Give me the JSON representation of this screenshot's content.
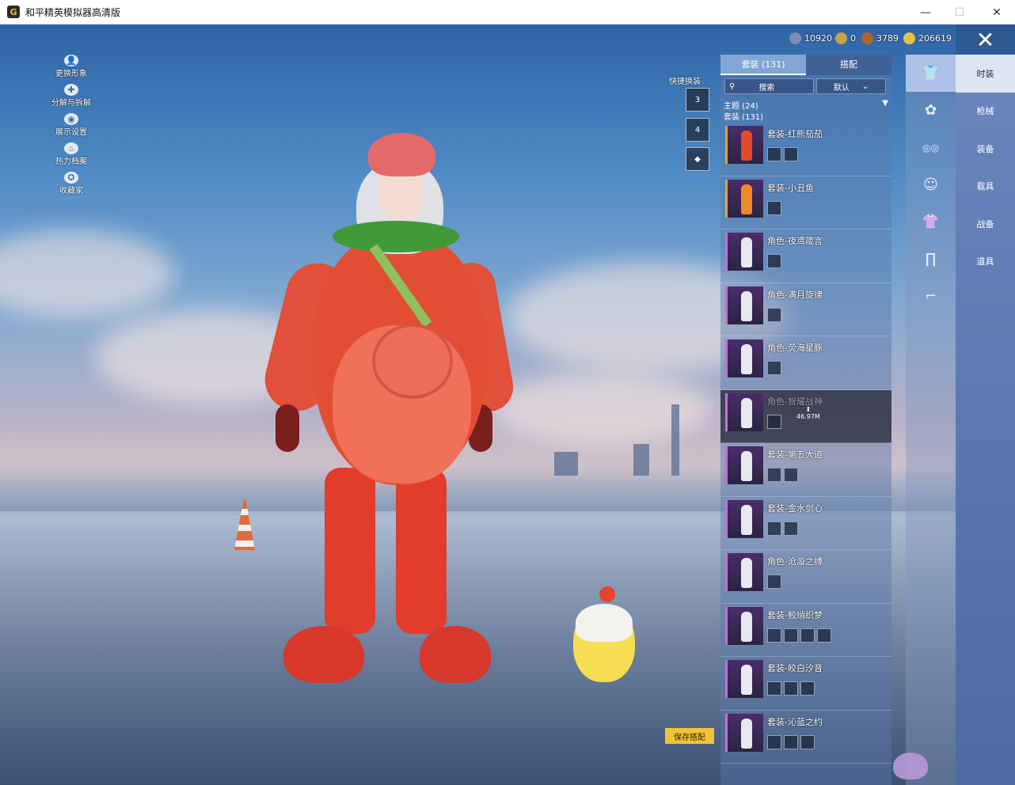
{
  "window": {
    "title": "和平精英模拟器高清版",
    "logo": "G",
    "minimize": "—",
    "maximize": "☐",
    "close": "✕"
  },
  "left_menu": [
    {
      "label": "更换形象",
      "icon": "person-icon",
      "glyph": "👤"
    },
    {
      "label": "分解与拆解",
      "icon": "puzzle-icon",
      "glyph": "✚"
    },
    {
      "label": "展示设置",
      "icon": "eye-icon",
      "glyph": "◉"
    },
    {
      "label": "热力档案",
      "icon": "flame-icon",
      "glyph": "♨"
    },
    {
      "label": "收藏家",
      "icon": "badge-icon",
      "glyph": "✪"
    }
  ],
  "currency": [
    {
      "value": "10920",
      "icon": "gem-icon",
      "color": "#7a8fb8"
    },
    {
      "value": "0",
      "icon": "medal-icon",
      "color": "#c9a14a"
    },
    {
      "value": "3789",
      "icon": "bronze-coin-icon",
      "color": "#b0662a"
    },
    {
      "value": "206619",
      "icon": "gold-coin-icon",
      "color": "#e6c34a"
    }
  ],
  "top_close": "✕",
  "quick_swap": {
    "label": "快捷换装",
    "slots": [
      "3",
      "4",
      "◆"
    ]
  },
  "list": {
    "tabs": [
      "套装 (131)",
      "搭配"
    ],
    "search_placeholder": "搜索",
    "sort": "默认",
    "theme": "主题 (24)",
    "theme_arrow": "▼",
    "set_count": "套装 (131)",
    "items": [
      {
        "name": "套装-红熊茄茄",
        "subs": 2,
        "fig": "red",
        "gold": true
      },
      {
        "name": "套装-小丑鱼",
        "subs": 1,
        "fig": "orange",
        "gold": true
      },
      {
        "name": "角色-夜鸢箴言",
        "subs": 1,
        "fig": "",
        "gold": false
      },
      {
        "name": "角色-满月旋律",
        "subs": 1,
        "fig": "",
        "gold": false
      },
      {
        "name": "角色-荧海星豚",
        "subs": 1,
        "fig": "",
        "gold": false
      },
      {
        "name": "角色-智耀战神",
        "subs": 1,
        "fig": "",
        "gold": false,
        "dim": true,
        "download": "46.97M"
      },
      {
        "name": "套装-第五大道",
        "subs": 2,
        "fig": "",
        "gold": false
      },
      {
        "name": "套装-金水剑心",
        "subs": 2,
        "fig": "",
        "gold": false
      },
      {
        "name": "角色-沧漩之缚",
        "subs": 1,
        "fig": "",
        "gold": false
      },
      {
        "name": "套装-鲛绡织梦",
        "subs": 4,
        "fig": "",
        "gold": false
      },
      {
        "name": "套装-皎白汐音",
        "subs": 3,
        "fig": "",
        "gold": false
      },
      {
        "name": "套装-沁蓝之约",
        "subs": 3,
        "fig": "",
        "gold": false
      }
    ]
  },
  "categories": [
    {
      "icon": "outfit-icon",
      "glyph": "👕"
    },
    {
      "icon": "hair-icon",
      "glyph": "✿"
    },
    {
      "icon": "glasses-icon",
      "glyph": "◎◎"
    },
    {
      "icon": "mask-icon",
      "glyph": "☺"
    },
    {
      "icon": "clothes-icon",
      "glyph": "👚"
    },
    {
      "icon": "pants-icon",
      "glyph": "∏"
    },
    {
      "icon": "shoes-icon",
      "glyph": "⌐"
    }
  ],
  "nav": [
    "时装",
    "枪械",
    "装备",
    "载具",
    "战备",
    "道具"
  ],
  "save_button": "保存搭配"
}
